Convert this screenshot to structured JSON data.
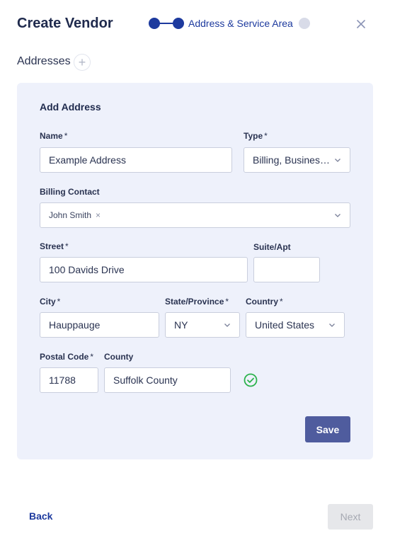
{
  "header": {
    "title": "Create Vendor",
    "step_label": "Address & Service Area"
  },
  "addresses": {
    "heading": "Addresses",
    "add_symbol": "+"
  },
  "form": {
    "panel_title": "Add Address",
    "name": {
      "label": "Name",
      "required": "*",
      "value": "Example Address"
    },
    "type": {
      "label": "Type",
      "required": "*",
      "value": "Billing, Business Address"
    },
    "billing_contact": {
      "label": "Billing Contact",
      "chip": "John Smith",
      "chip_remove": "×"
    },
    "street": {
      "label": "Street",
      "required": "*",
      "value": "100 Davids Drive"
    },
    "suite": {
      "label": "Suite/Apt",
      "value": ""
    },
    "city": {
      "label": "City",
      "required": "*",
      "value": "Hauppauge"
    },
    "state": {
      "label": "State/Province",
      "required": "*",
      "value": "NY"
    },
    "country": {
      "label": "Country",
      "required": "*",
      "value": "United States"
    },
    "postal_code": {
      "label": "Postal Code",
      "required": "*",
      "value": "11788"
    },
    "county": {
      "label": "County",
      "value": "Suffolk County"
    },
    "save_label": "Save"
  },
  "footer": {
    "back_label": "Back",
    "next_label": "Next"
  },
  "colors": {
    "primary": "#1d3a9e",
    "panel_bg": "#eef1fb",
    "save_bg": "#4f5c9e",
    "success": "#2bb24c",
    "disabled_bg": "#e6e7ea"
  },
  "icons": {
    "close": "close-icon",
    "add": "plus-icon",
    "dropdown": "chevron-down-icon",
    "valid": "check-circle-icon"
  }
}
